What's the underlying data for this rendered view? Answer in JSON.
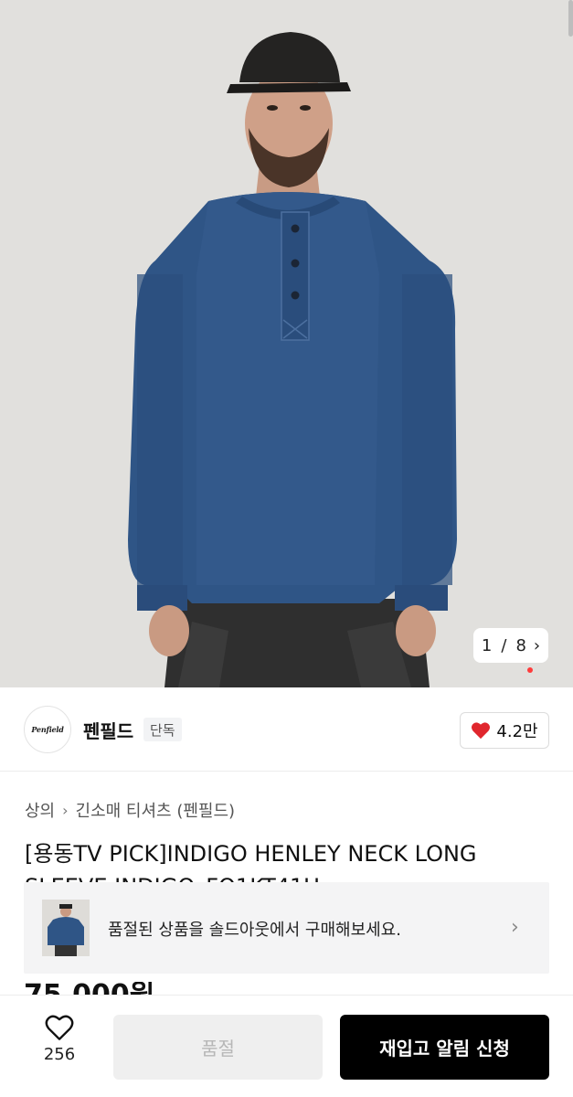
{
  "gallery": {
    "current": "1",
    "separator": "/",
    "total": "8",
    "next_icon": "chevron-right-icon",
    "active_dot_color": "#ff3b3b"
  },
  "brand": {
    "logo_text": "Penfield",
    "name": "펜필드",
    "badge": "단독",
    "like_count": "4.2만",
    "like_icon": "heart-filled-icon",
    "like_color": "#e0262d"
  },
  "breadcrumb": {
    "items": [
      "상의",
      "긴소매 티셔츠 (펜필드)"
    ],
    "separator_icon": "chevron-right-icon"
  },
  "product": {
    "title": "[용동TV PICK]INDIGO HENLEY NECK LONG SLEEVE INDIGO_FO1KT41U",
    "price_peek": "75,000원"
  },
  "soldout_banner": {
    "text": "품절된 상품을 솔드아웃에서 구매해보세요.",
    "chevron_icon": "chevron-right-icon"
  },
  "bottom_bar": {
    "wish_icon": "heart-outline-icon",
    "wish_count": "256",
    "soldout_label": "품절",
    "restock_label": "재입고 알림 신청"
  }
}
